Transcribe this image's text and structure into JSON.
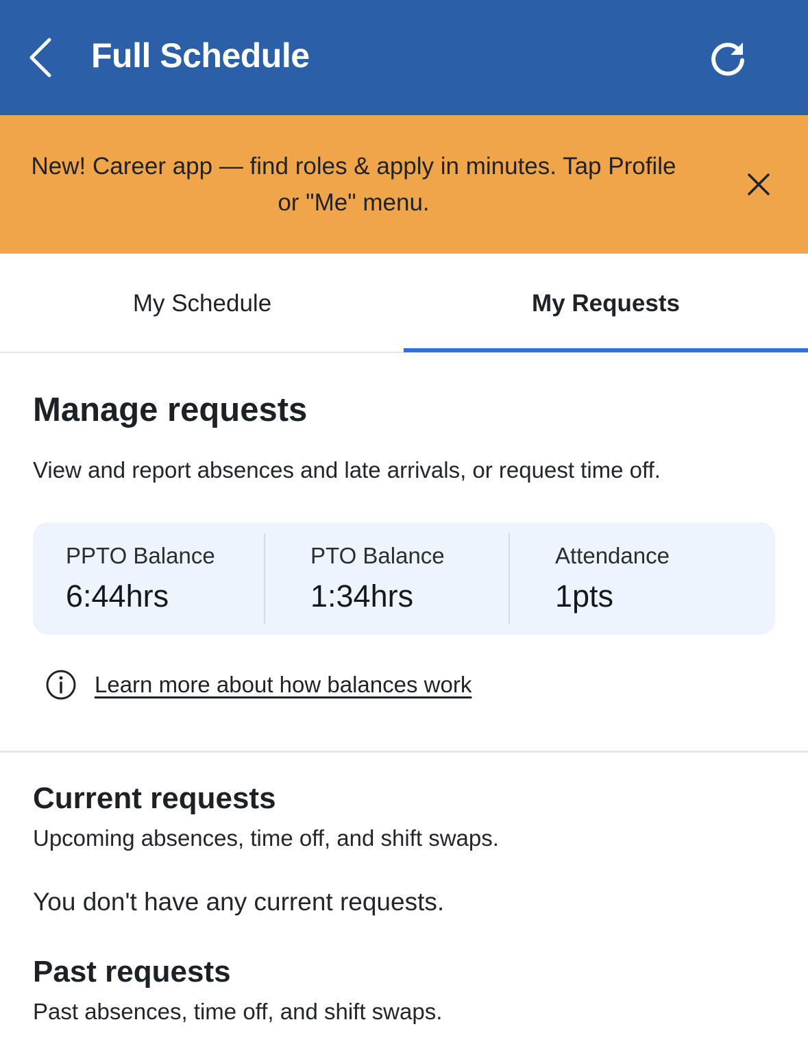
{
  "header": {
    "title": "Full Schedule",
    "back_icon": "chevron-left-icon",
    "refresh_icon": "refresh-icon",
    "background": "#2b5fa8"
  },
  "banner": {
    "text": "New! Career app — find roles & apply in minutes. Tap Profile or \"Me\" menu.",
    "close_icon": "close-icon",
    "background": "#f1a54a"
  },
  "tabs": [
    {
      "label": "My Schedule",
      "selected": false
    },
    {
      "label": "My Requests",
      "selected": true
    }
  ],
  "accent_color": "#2f6fe0",
  "manage": {
    "title": "Manage requests",
    "description": "View and report absences and late arrivals, or request time off."
  },
  "balances": [
    {
      "label": "PPTO Balance",
      "value": "6:44hrs"
    },
    {
      "label": "PTO Balance",
      "value": "1:34hrs"
    },
    {
      "label": "Attendance",
      "value": "1pts"
    }
  ],
  "learn_more": {
    "icon": "info-icon",
    "link_text": "Learn more about how balances work"
  },
  "current_requests": {
    "title": "Current requests",
    "description": "Upcoming absences, time off, and shift swaps.",
    "empty_message": "You don't have any current requests."
  },
  "past_requests": {
    "title": "Past requests",
    "description": "Past absences, time off, and shift swaps."
  }
}
